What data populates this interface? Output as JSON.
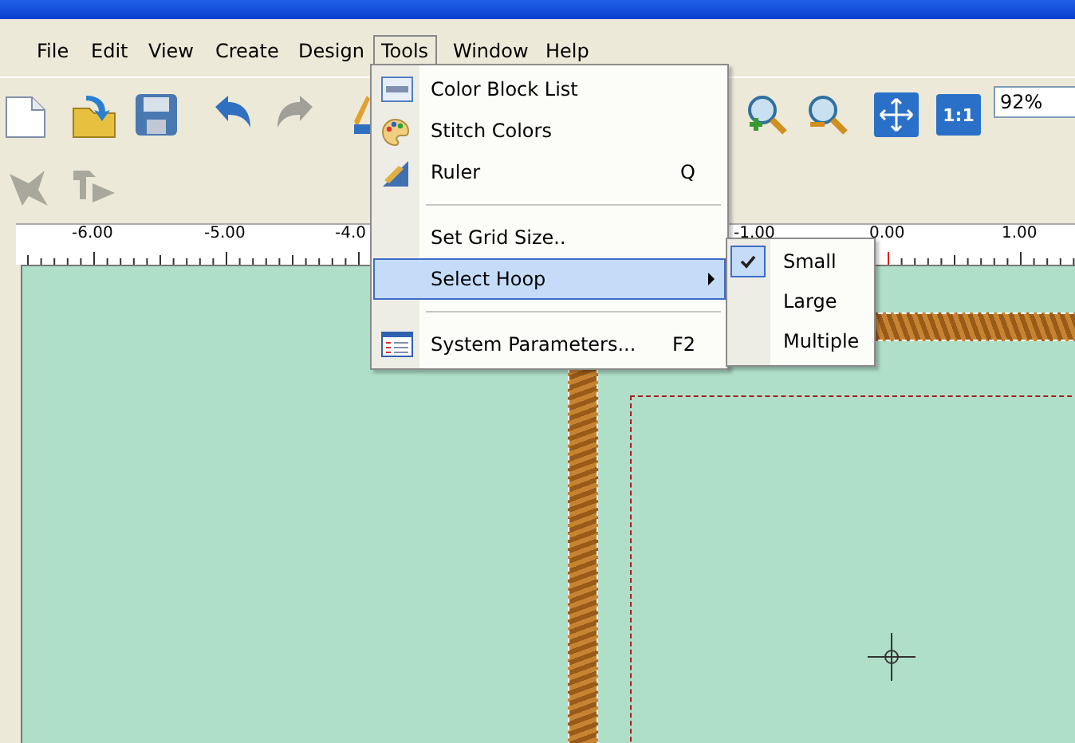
{
  "menu_bar": [
    {
      "label": "File",
      "selected": false
    },
    {
      "label": "Edit",
      "selected": false
    },
    {
      "label": "View",
      "selected": false
    },
    {
      "label": "Create",
      "selected": false
    },
    {
      "label": "Design",
      "selected": false
    },
    {
      "label": "Tools",
      "selected": true
    },
    {
      "label": "Window",
      "selected": false
    },
    {
      "label": "Help",
      "selected": false
    }
  ],
  "toolbar": {
    "actual_size_button": "1:1",
    "zoom_field": "92%"
  },
  "ruler": {
    "labels": [
      "-6.00",
      "-5.00",
      "-4.0",
      "-1.00",
      "0.00",
      "1.00"
    ]
  },
  "tools_menu": [
    {
      "kind": "item",
      "label": "Color Block List",
      "selected": false
    },
    {
      "kind": "item",
      "label": "Stitch Colors",
      "selected": false
    },
    {
      "kind": "item",
      "label": "Ruler",
      "shortcut": "Q",
      "selected": false
    },
    {
      "kind": "separator"
    },
    {
      "kind": "item",
      "label": "Set Grid Size..",
      "selected": false
    },
    {
      "kind": "submenu",
      "label": "Select Hoop",
      "selected": true
    },
    {
      "kind": "separator"
    },
    {
      "kind": "item",
      "label": "System Parameters...",
      "shortcut": "F2",
      "selected": false
    }
  ],
  "hoop_submenu": [
    {
      "label": "Small",
      "checked": true
    },
    {
      "label": "Large",
      "checked": false
    },
    {
      "label": "Multiple",
      "checked": false
    }
  ]
}
